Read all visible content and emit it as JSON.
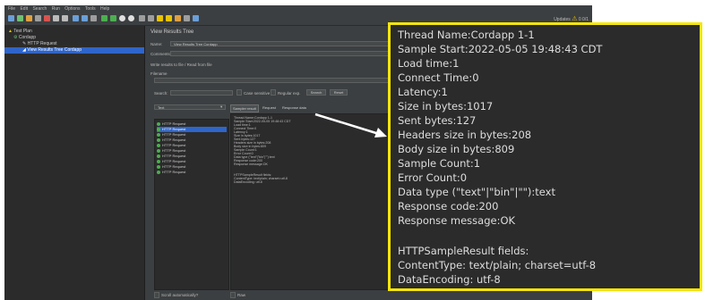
{
  "menubar": {
    "items": [
      "File",
      "Edit",
      "Search",
      "Run",
      "Options",
      "Tools",
      "Help"
    ]
  },
  "toolbar": {
    "status_text": "Updates",
    "warning_count": "0",
    "ratio": "0/1"
  },
  "tree": {
    "root": "Cordapp",
    "test_plan": "Test Plan",
    "items": [
      "HTTP Request",
      "View Results Tree Cordapp"
    ]
  },
  "panel": {
    "title": "View Results Tree",
    "name_label": "Name:",
    "name_value": "View Results Tree Cordapp",
    "comments_label": "Comments:",
    "write_all_label": "Write results to file / Read from file",
    "filename_label": "Filename",
    "search_label": "Search:",
    "case_sensitive_label": "Case sensitive",
    "regex_label": "Regular exp.",
    "search_button": "Search",
    "reset_button": "Reset",
    "renderer_value": "Text",
    "tabs": [
      "Sampler result",
      "Request",
      "Response data"
    ],
    "results": [
      "HTTP Request",
      "HTTP Request",
      "HTTP Request",
      "HTTP Request",
      "HTTP Request",
      "HTTP Request",
      "HTTP Request",
      "HTTP Request",
      "HTTP Request",
      "HTTP Request"
    ],
    "scroll_label": "Scroll automatically?",
    "raw_label": "Raw"
  },
  "details": [
    "Thread Name:Cordapp 1-1",
    "Sample Start:2022-05-05 19:48:43 CDT",
    "Load time:1",
    "Connect Time:0",
    "Latency:1",
    "Size in bytes:1017",
    "Sent bytes:127",
    "Headers size in bytes:208",
    "Body size in bytes:809",
    "Sample Count:1",
    "Error Count:0",
    "Data type (\"text\"|\"bin\"|\"\"):text",
    "Response code:200",
    "Response message:OK",
    "",
    "",
    "HTTPSampleResult fields:",
    "ContentType: text/plain; charset=utf-8",
    "DataEncoding: utf-8"
  ],
  "colors": {
    "callout_border": "#f5e60a",
    "selection": "#2f65ca",
    "background": "#3c3f41"
  }
}
